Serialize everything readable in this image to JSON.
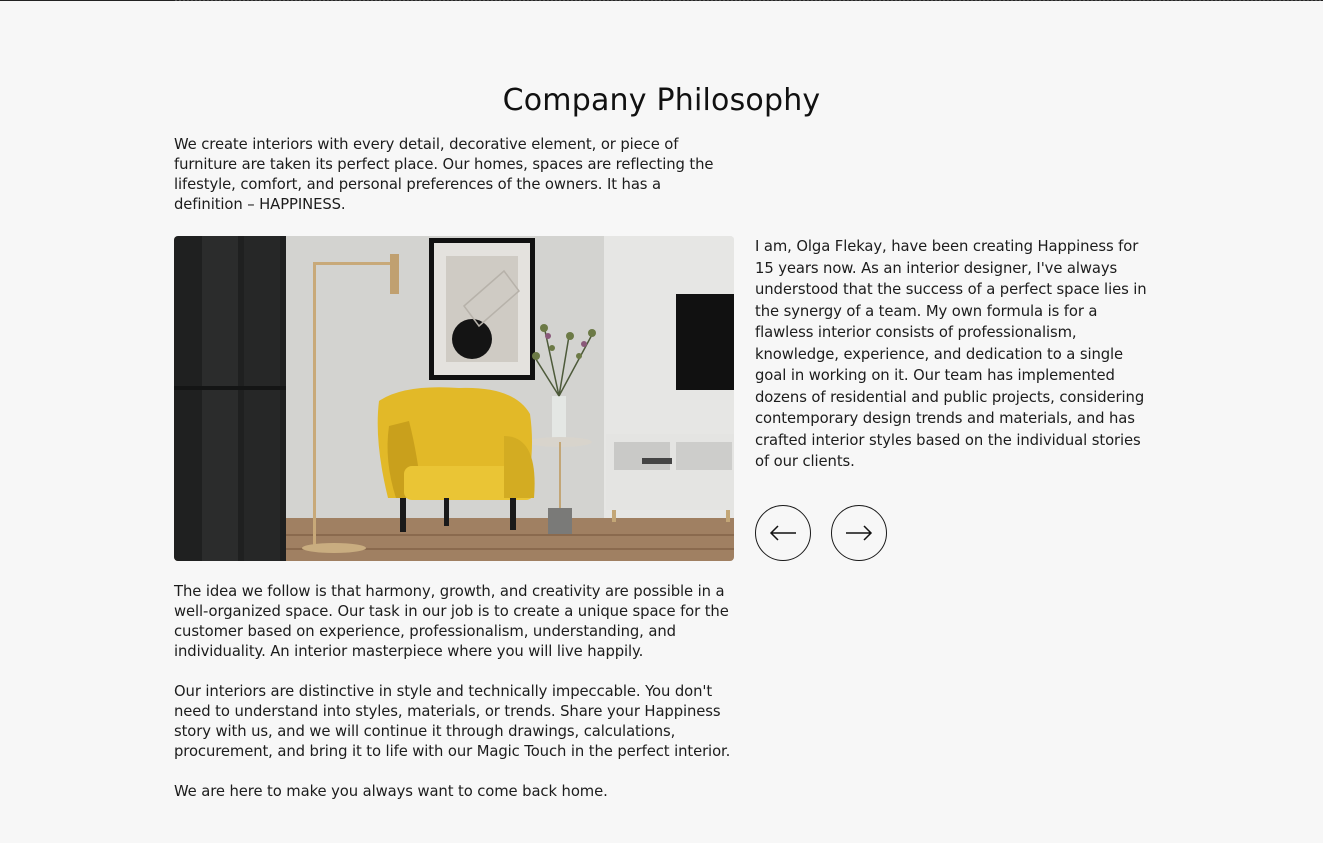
{
  "section": {
    "title": "Company Philosophy",
    "intro": "We create interiors with every detail, decorative element, or piece of furniture are taken its perfect place. Our homes, spaces are reflecting the lifestyle, comfort, and personal preferences of the owners. It has a definition – HAPPINESS.",
    "quote": "I am, Olga Flekay, have been creating Happiness for 15 years now. As an interior designer, I've always understood that the success of a perfect space lies in the synergy of a team. My own formula is for a flawless interior consists of professionalism, knowledge, experience, and dedication to a single goal in working on it. Our team has implemented dozens of residential and public projects, considering contemporary design trends and materials, and has crafted interior styles based on the individual stories of our clients.",
    "paragraphs": [
      "The idea we follow is that harmony, growth, and creativity are possible in a well-organized space. Our task in our job is to create a unique space for the customer based on experience, professionalism, understanding, and individuality. An interior masterpiece where you will live happily.",
      "Our interiors are distinctive in style and technically impeccable. You don't need to understand into styles, materials, or trends. Share your Happiness story with us, and we will continue it through drawings, calculations, procurement, and bring it to life with our Magic Touch in the perfect interior.",
      "We are here to make you always want to come back home."
    ]
  },
  "slider": {
    "prev_icon": "arrow-left-icon",
    "next_icon": "arrow-right-icon"
  },
  "colors": {
    "background": "#f7f7f7",
    "text": "#1a1a1a",
    "chair": "#e8c22e"
  }
}
